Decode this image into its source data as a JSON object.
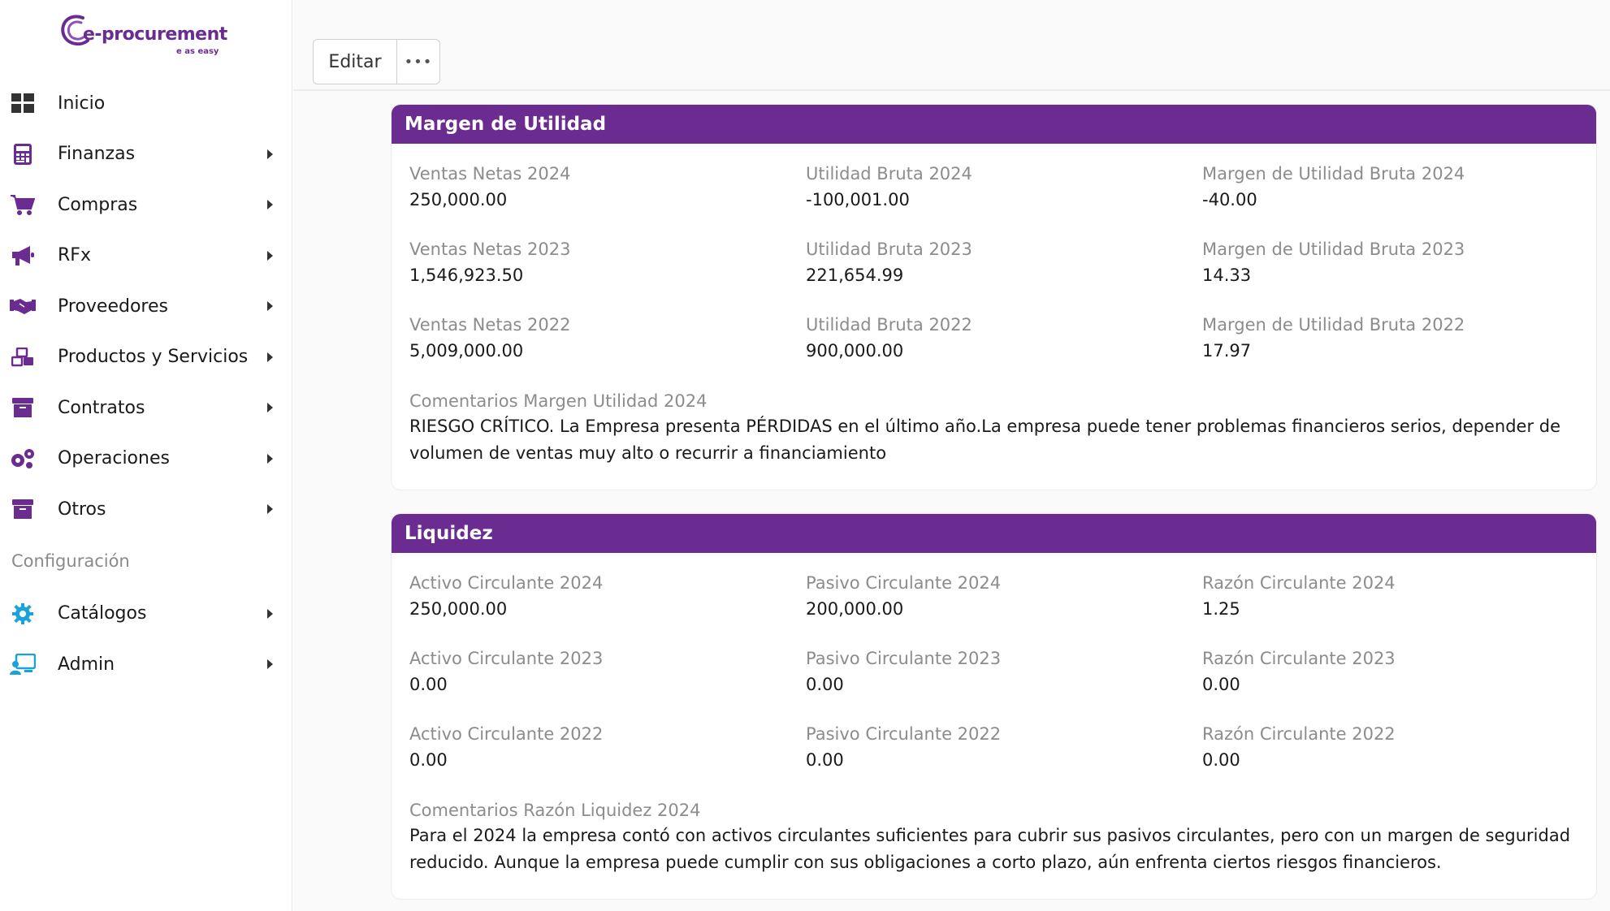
{
  "brand": {
    "name": "e-procurement",
    "tagline": "e as easy",
    "color": "#6b2c91"
  },
  "sidebar": {
    "items": [
      {
        "label": "Inicio",
        "icon": "dashboard-icon",
        "has_caret": false
      },
      {
        "label": "Finanzas",
        "icon": "calculator-icon",
        "has_caret": true
      },
      {
        "label": "Compras",
        "icon": "cart-icon",
        "has_caret": true
      },
      {
        "label": "RFx",
        "icon": "megaphone-icon",
        "has_caret": true
      },
      {
        "label": "Proveedores",
        "icon": "handshake-icon",
        "has_caret": true
      },
      {
        "label": "Productos y Servicios",
        "icon": "boxes-icon",
        "has_caret": true
      },
      {
        "label": "Contratos",
        "icon": "archive-icon",
        "has_caret": true
      },
      {
        "label": "Operaciones",
        "icon": "gears-icon",
        "has_caret": true
      },
      {
        "label": "Otros",
        "icon": "archive-icon",
        "has_caret": true
      }
    ],
    "section_label": "Configuración",
    "config_items": [
      {
        "label": "Catálogos",
        "icon": "gear-icon",
        "has_caret": true
      },
      {
        "label": "Admin",
        "icon": "admin-screen-icon",
        "has_caret": true
      }
    ]
  },
  "toolbar": {
    "edit_label": "Editar",
    "more_label": "•••"
  },
  "margen": {
    "title": "Margen de Utilidad",
    "fields": [
      {
        "label": "Ventas Netas 2024",
        "value": "250,000.00"
      },
      {
        "label": "Utilidad Bruta 2024",
        "value": "-100,001.00"
      },
      {
        "label": "Margen de Utilidad Bruta 2024",
        "value": "-40.00"
      },
      {
        "label": "Ventas Netas 2023",
        "value": "1,546,923.50"
      },
      {
        "label": "Utilidad Bruta 2023",
        "value": "221,654.99"
      },
      {
        "label": "Margen de Utilidad Bruta 2023",
        "value": "14.33"
      },
      {
        "label": "Ventas Netas 2022",
        "value": "5,009,000.00"
      },
      {
        "label": "Utilidad Bruta 2022",
        "value": "900,000.00"
      },
      {
        "label": "Margen de Utilidad Bruta 2022",
        "value": "17.97"
      }
    ],
    "comment_label": "Comentarios Margen Utilidad 2024",
    "comment_text": "RIESGO CRÍTICO. La Empresa presenta PÉRDIDAS en el último año.La empresa puede tener problemas financieros serios, depender de volumen de ventas muy alto o recurrir a financiamiento"
  },
  "liquidez": {
    "title": "Liquidez",
    "fields": [
      {
        "label": "Activo Circulante 2024",
        "value": "250,000.00"
      },
      {
        "label": "Pasivo Circulante 2024",
        "value": "200,000.00"
      },
      {
        "label": "Razón Circulante 2024",
        "value": "1.25"
      },
      {
        "label": "Activo Circulante 2023",
        "value": "0.00"
      },
      {
        "label": "Pasivo Circulante 2023",
        "value": "0.00"
      },
      {
        "label": "Razón Circulante 2023",
        "value": "0.00"
      },
      {
        "label": "Activo Circulante 2022",
        "value": "0.00"
      },
      {
        "label": "Pasivo Circulante 2022",
        "value": "0.00"
      },
      {
        "label": "Razón Circulante 2022",
        "value": "0.00"
      }
    ],
    "comment_label": "Comentarios Razón Liquidez 2024",
    "comment_text": "Para el 2024 la empresa contó con activos circulantes suficientes para cubrir sus pasivos circulantes, pero con un margen de seguridad reducido. Aunque la empresa puede cumplir con sus obligaciones a corto plazo, aún enfrenta ciertos riesgos financieros."
  }
}
